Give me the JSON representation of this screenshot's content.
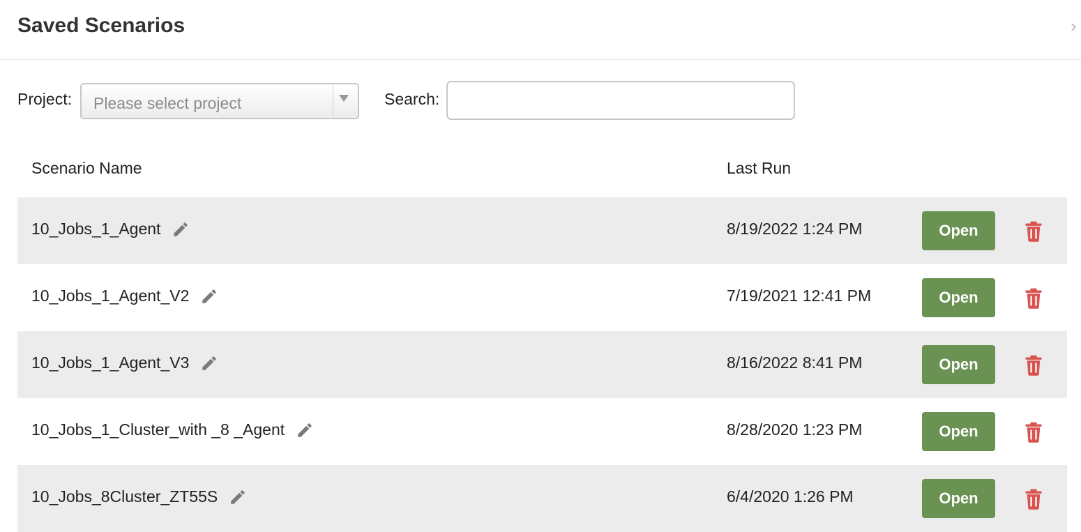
{
  "header": {
    "title": "Saved Scenarios",
    "close_glyph": "›"
  },
  "filters": {
    "project_label": "Project:",
    "project_value": "Please select project",
    "search_label": "Search:",
    "search_value": ""
  },
  "table": {
    "columns": [
      "Scenario Name",
      "Last Run"
    ],
    "open_label": "Open",
    "rows": [
      {
        "name": "10_Jobs_1_Agent",
        "last_run": "8/19/2022 1:24 PM"
      },
      {
        "name": "10_Jobs_1_Agent_V2",
        "last_run": "7/19/2021 12:41 PM"
      },
      {
        "name": "10_Jobs_1_Agent_V3",
        "last_run": "8/16/2022 8:41 PM"
      },
      {
        "name": "10_Jobs_1_Cluster_with _8 _Agent",
        "last_run": "8/28/2020 1:23 PM"
      },
      {
        "name": "10_Jobs_8Cluster_ZT55S",
        "last_run": "6/4/2020 1:26 PM"
      }
    ]
  },
  "icons": {
    "edit": "pencil-icon",
    "delete": "trash-icon",
    "dropdown": "chevron-down-icon",
    "close": "close-icon"
  },
  "colors": {
    "open_button": "#6a9253",
    "delete_icon": "#d9534f",
    "row_stripe": "#ececec",
    "edit_icon": "#7a7a7a"
  }
}
